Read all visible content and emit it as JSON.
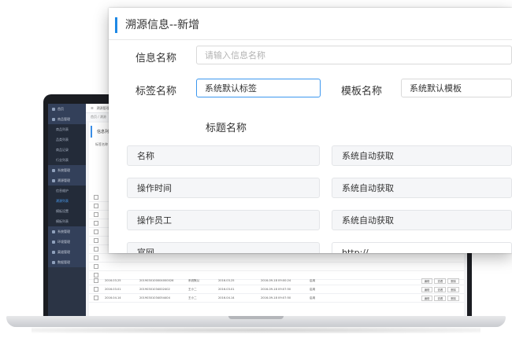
{
  "form": {
    "title": "溯源信息--新增",
    "info_name_label": "信息名称",
    "info_name_placeholder": "请输入信息名称",
    "tag_name_label": "标签名称",
    "tag_name_value": "系统默认标签",
    "template_name_label": "模板名称",
    "template_name_value": "系统默认模板",
    "heading_name_label": "标题名称",
    "rows": [
      {
        "name": "名称",
        "value": "系统自动获取"
      },
      {
        "name": "操作时间",
        "value": "系统自动获取"
      },
      {
        "name": "操作员工",
        "value": "系统自动获取"
      },
      {
        "name": "官网",
        "value": "http://"
      }
    ]
  },
  "laptop_ui": {
    "sidebar": [
      {
        "label": "首页",
        "type": "group"
      },
      {
        "label": "商品管理",
        "type": "group"
      },
      {
        "label": "商品列表",
        "type": "sub"
      },
      {
        "label": "品类列表",
        "type": "sub"
      },
      {
        "label": "商品记录",
        "type": "sub"
      },
      {
        "label": "行业列表",
        "type": "sub"
      },
      {
        "label": "系统管理",
        "type": "group"
      },
      {
        "label": "溯源管理",
        "type": "group"
      },
      {
        "label": "信息维护",
        "type": "sub"
      },
      {
        "label": "溯源列表",
        "type": "sub",
        "active": true
      },
      {
        "label": "模板设置",
        "type": "sub"
      },
      {
        "label": "模板列表",
        "type": "sub"
      },
      {
        "label": "系统管理",
        "type": "group"
      },
      {
        "label": "环境管理",
        "type": "group"
      },
      {
        "label": "渠道管理",
        "type": "group"
      },
      {
        "label": "数据管理",
        "type": "group"
      }
    ],
    "topbar_title": "溯源管理",
    "breadcrumb": "首页 / 溯源",
    "panel_title": "信息列表",
    "filter_label": "标签名称",
    "table_rows": [
      {
        "date": "2016.03.25",
        "code": "2019030100004000026",
        "label": "系统默认",
        "created": "2016.03.25",
        "updated": "2016-09-18 09:00:24",
        "status": "启用"
      },
      {
        "date": "2016.03.01",
        "code": "20190301034002402",
        "label": "王小二",
        "created": "2016.03.01",
        "updated": "2016-09-18 09:07:50",
        "status": "启用"
      },
      {
        "date": "2016.04.14",
        "code": "20190301034054404",
        "label": "王小二",
        "created": "2016.04.14",
        "updated": "2016-09-18 09:07:50",
        "status": "启用"
      }
    ],
    "row_buttons": [
      "编辑",
      "查看",
      "删除"
    ]
  }
}
